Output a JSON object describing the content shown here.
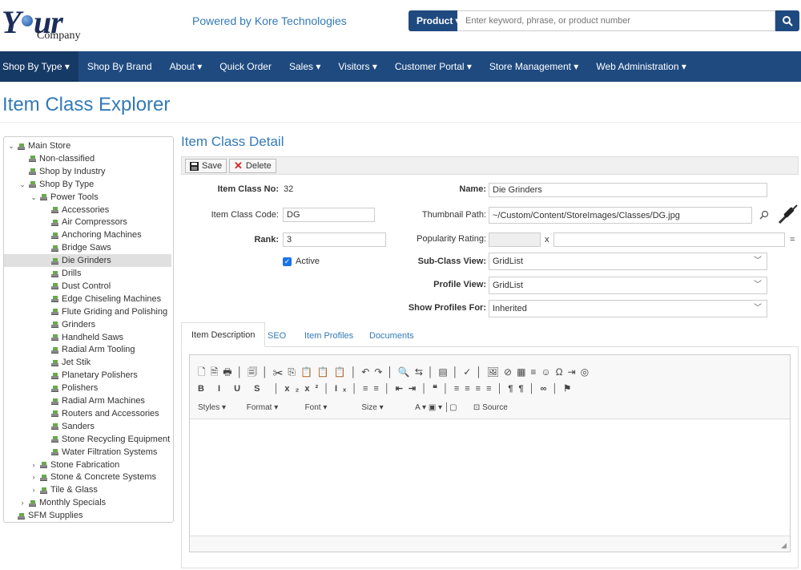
{
  "header": {
    "logo_main": "Y",
    "logo_main2": "ur",
    "logo_sub": "Company",
    "powered": "Powered by Kore Technologies",
    "product_label": "Product ▾",
    "search_placeholder": "Enter keyword, phrase, or product number"
  },
  "nav": [
    "Shop By Type ▾",
    "Shop By Brand",
    "About ▾",
    "Quick Order",
    "Sales ▾",
    "Visitors ▾",
    "Customer Portal ▾",
    "Store Management ▾",
    "Web Administration ▾"
  ],
  "page_title": "Item Class Explorer",
  "tree": [
    {
      "label": "Main Store",
      "caret": "⌄"
    },
    {
      "label": "Non-classified",
      "caret": ""
    },
    {
      "label": "Shop by Industry",
      "caret": ""
    },
    {
      "label": "Shop By Type",
      "caret": "⌄"
    },
    {
      "label": "Power Tools",
      "caret": "⌄"
    },
    {
      "label": "Accessories",
      "caret": ""
    },
    {
      "label": "Air Compressors",
      "caret": ""
    },
    {
      "label": "Anchoring Machines",
      "caret": ""
    },
    {
      "label": "Bridge Saws",
      "caret": ""
    },
    {
      "label": "Die Grinders",
      "caret": ""
    },
    {
      "label": "Drills",
      "caret": ""
    },
    {
      "label": "Dust Control",
      "caret": ""
    },
    {
      "label": "Edge Chiseling Machines",
      "caret": ""
    },
    {
      "label": "Flute Griding and Polishing",
      "caret": ""
    },
    {
      "label": "Grinders",
      "caret": ""
    },
    {
      "label": "Handheld Saws",
      "caret": ""
    },
    {
      "label": "Radial Arm Tooling",
      "caret": ""
    },
    {
      "label": "Jet Stik",
      "caret": ""
    },
    {
      "label": "Planetary Polishers",
      "caret": ""
    },
    {
      "label": "Polishers",
      "caret": ""
    },
    {
      "label": "Radial Arm Machines",
      "caret": ""
    },
    {
      "label": "Routers and Accessories",
      "caret": ""
    },
    {
      "label": "Sanders",
      "caret": ""
    },
    {
      "label": "Stone Recycling Equipment",
      "caret": ""
    },
    {
      "label": "Water Filtration Systems",
      "caret": ""
    },
    {
      "label": "Stone Fabrication",
      "caret": "›"
    },
    {
      "label": "Stone & Concrete Systems",
      "caret": "›"
    },
    {
      "label": "Tile & Glass",
      "caret": "›"
    },
    {
      "label": "Monthly Specials",
      "caret": "›"
    },
    {
      "label": "SFM Supplies",
      "caret": ""
    }
  ],
  "detail": {
    "title": "Item Class Detail",
    "save": "Save",
    "delete": "Delete",
    "item_class_no_label": "Item Class No:",
    "item_class_no": "32",
    "item_class_code_label": "Item Class Code:",
    "item_class_code": "DG",
    "rank_label": "Rank:",
    "rank": "3",
    "active_label": "Active",
    "name_label": "Name:",
    "name": "Die Grinders",
    "thumb_label": "Thumbnail Path:",
    "thumb": "~/Custom/Content/StoreImages/Classes/DG.jpg",
    "popularity_label": "Popularity Rating:",
    "popularity_x": "x",
    "popularity_eq": "=",
    "subclass_label": "Sub-Class View:",
    "subclass": "GridList",
    "profile_label": "Profile View:",
    "profile": "GridList",
    "show_profiles_label": "Show Profiles For:",
    "show_profiles": "Inherited"
  },
  "tabs": [
    "Item Description",
    "SEO",
    "Item Profiles",
    "Documents"
  ],
  "editor": {
    "row3": [
      "Styles",
      "Format",
      "Font",
      "Size",
      "Source"
    ]
  }
}
